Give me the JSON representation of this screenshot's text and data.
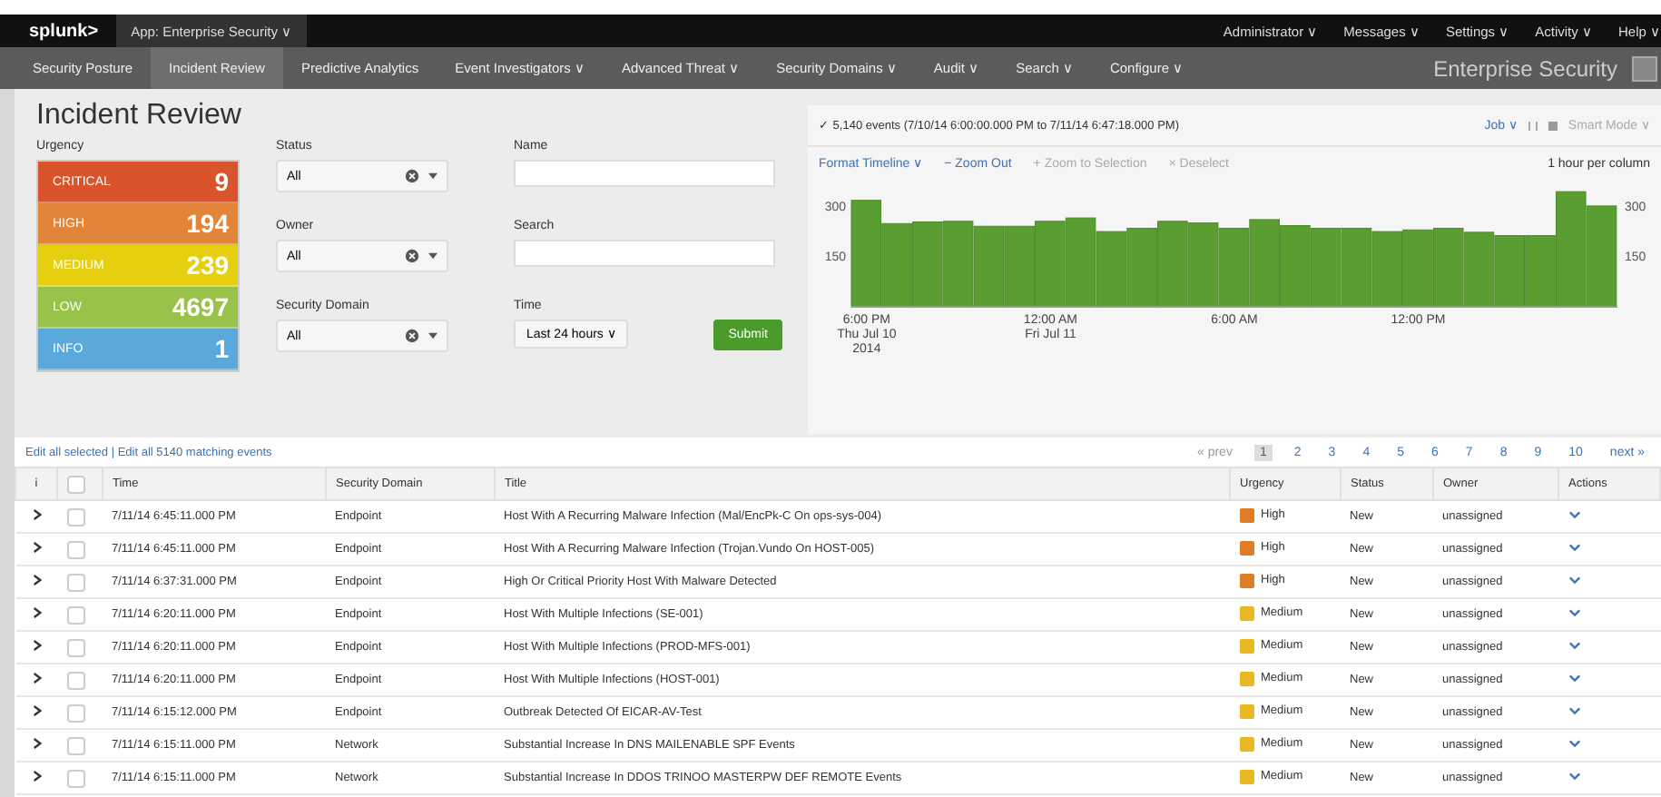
{
  "top_bar": {
    "logo": "splunk>",
    "app": "App: Enterprise Security ∨",
    "menus": [
      "Administrator ∨",
      "Messages ∨",
      "Settings ∨",
      "Activity ∨",
      "Help ∨"
    ]
  },
  "nav": {
    "items": [
      {
        "label": "Security Posture",
        "selected": false
      },
      {
        "label": "Incident Review",
        "selected": true
      },
      {
        "label": "Predictive Analytics",
        "selected": false
      },
      {
        "label": "Event Investigators ∨",
        "selected": false
      },
      {
        "label": "Advanced Threat ∨",
        "selected": false
      },
      {
        "label": "Security Domains ∨",
        "selected": false
      },
      {
        "label": "Audit ∨",
        "selected": false
      },
      {
        "label": "Search ∨",
        "selected": false
      },
      {
        "label": "Configure ∨",
        "selected": false
      }
    ],
    "app_name": "Enterprise Security"
  },
  "page_title": "Incident Review",
  "urgency": {
    "label": "Urgency",
    "levels": [
      {
        "name": "CRITICAL",
        "count": "9",
        "color": "#d9542b"
      },
      {
        "name": "HIGH",
        "count": "194",
        "color": "#e38539"
      },
      {
        "name": "MEDIUM",
        "count": "239",
        "color": "#e5cf0e"
      },
      {
        "name": "LOW",
        "count": "4697",
        "color": "#98c24a"
      },
      {
        "name": "INFO",
        "count": "1",
        "color": "#5ba8dc"
      }
    ]
  },
  "filters": {
    "selects": [
      {
        "label": "Status",
        "value": "All"
      },
      {
        "label": "Owner",
        "value": "All"
      },
      {
        "label": "Security Domain",
        "value": "All"
      }
    ],
    "fields": [
      {
        "label": "Name"
      },
      {
        "label": "Search"
      }
    ],
    "time": {
      "label": "Time",
      "value": "Last 24 hours ∨"
    },
    "submit": "Submit"
  },
  "timeline": {
    "status": "✓ 5,140 events (7/10/14 6:00:00.000 PM to 7/11/14 6:47:18.000 PM)",
    "job": "Job ∨",
    "mode": "Smart Mode ∨",
    "tools": [
      {
        "label": "Format Timeline ∨",
        "disabled": false
      },
      {
        "label": "− Zoom Out",
        "disabled": false
      },
      {
        "label": "+ Zoom to Selection",
        "disabled": true
      },
      {
        "label": "× Deselect",
        "disabled": true
      }
    ],
    "scale": "1 hour per column",
    "right_axis_labels": [
      "300",
      "150"
    ],
    "chart_data": {
      "type": "bar",
      "categories": [
        "6:00 PM\nThu Jul 10\n2014",
        null,
        null,
        null,
        null,
        null,
        "12:00 AM\nFri Jul 11",
        null,
        null,
        null,
        null,
        null,
        "6:00 AM",
        null,
        null,
        null,
        null,
        null,
        "12:00 PM",
        null,
        null,
        null,
        null,
        null,
        null
      ],
      "series": [
        {
          "color": "#5a9e32",
          "values": [
            320,
            250,
            255,
            257,
            242,
            242,
            257,
            267,
            226,
            236,
            257,
            252,
            236,
            262,
            244,
            236,
            236,
            226,
            231,
            236,
            224,
            214,
            214,
            346,
            303
          ]
        }
      ],
      "ylim": [
        0,
        360
      ],
      "yticks": [
        150,
        300
      ]
    }
  },
  "table": {
    "edit_links": [
      "Edit all selected",
      "Edit all 5140 matching events"
    ],
    "link_separator": "|",
    "select_all_checked": false,
    "pagination": {
      "prev": "« prev",
      "pages": [
        {
          "label": "1",
          "selected": true
        },
        {
          "label": "2",
          "selected": false
        },
        {
          "label": "3",
          "selected": false
        },
        {
          "label": "4",
          "selected": false
        },
        {
          "label": "5",
          "selected": false
        },
        {
          "label": "6",
          "selected": false
        },
        {
          "label": "7",
          "selected": false
        },
        {
          "label": "8",
          "selected": false
        },
        {
          "label": "9",
          "selected": false
        },
        {
          "label": "10",
          "selected": false
        }
      ],
      "next": "next »"
    },
    "columns": [
      "i",
      "Time",
      "Security Domain",
      "Title",
      "Urgency",
      "Status",
      "Owner",
      "Actions"
    ],
    "rows": [
      {
        "checked": false,
        "time": "7/11/14 6:45:11.000 PM",
        "domain": "Endpoint",
        "title": "Host With A Recurring Malware Infection (Mal/EncPk-C On ops-sys-004)",
        "urgency": "High",
        "color": "#e07b26",
        "status": "New",
        "owner": "unassigned"
      },
      {
        "checked": false,
        "time": "7/11/14 6:45:11.000 PM",
        "domain": "Endpoint",
        "title": "Host With A Recurring Malware Infection (Trojan.Vundo On HOST-005)",
        "urgency": "High",
        "color": "#e07b26",
        "status": "New",
        "owner": "unassigned"
      },
      {
        "checked": false,
        "time": "7/11/14 6:37:31.000 PM",
        "domain": "Endpoint",
        "title": "High Or Critical Priority Host With Malware Detected",
        "urgency": "High",
        "color": "#e07b26",
        "status": "New",
        "owner": "unassigned"
      },
      {
        "checked": false,
        "time": "7/11/14 6:20:11.000 PM",
        "domain": "Endpoint",
        "title": "Host With Multiple Infections (SE-001)",
        "urgency": "Medium",
        "color": "#e8b923",
        "status": "New",
        "owner": "unassigned"
      },
      {
        "checked": false,
        "time": "7/11/14 6:20:11.000 PM",
        "domain": "Endpoint",
        "title": "Host With Multiple Infections (PROD-MFS-001)",
        "urgency": "Medium",
        "color": "#e8b923",
        "status": "New",
        "owner": "unassigned"
      },
      {
        "checked": false,
        "time": "7/11/14 6:20:11.000 PM",
        "domain": "Endpoint",
        "title": "Host With Multiple Infections (HOST-001)",
        "urgency": "Medium",
        "color": "#e8b923",
        "status": "New",
        "owner": "unassigned"
      },
      {
        "checked": false,
        "time": "7/11/14 6:15:12.000 PM",
        "domain": "Endpoint",
        "title": "Outbreak Detected Of EICAR-AV-Test",
        "urgency": "Medium",
        "color": "#e8b923",
        "status": "New",
        "owner": "unassigned"
      },
      {
        "checked": false,
        "time": "7/11/14 6:15:11.000 PM",
        "domain": "Network",
        "title": "Substantial Increase In DNS MAILENABLE SPF Events",
        "urgency": "Medium",
        "color": "#e8b923",
        "status": "New",
        "owner": "unassigned"
      },
      {
        "checked": false,
        "time": "7/11/14 6:15:11.000 PM",
        "domain": "Network",
        "title": "Substantial Increase In DDOS TRINOO MASTERPW DEF REMOTE Events",
        "urgency": "Medium",
        "color": "#e8b923",
        "status": "New",
        "owner": "unassigned"
      }
    ]
  }
}
